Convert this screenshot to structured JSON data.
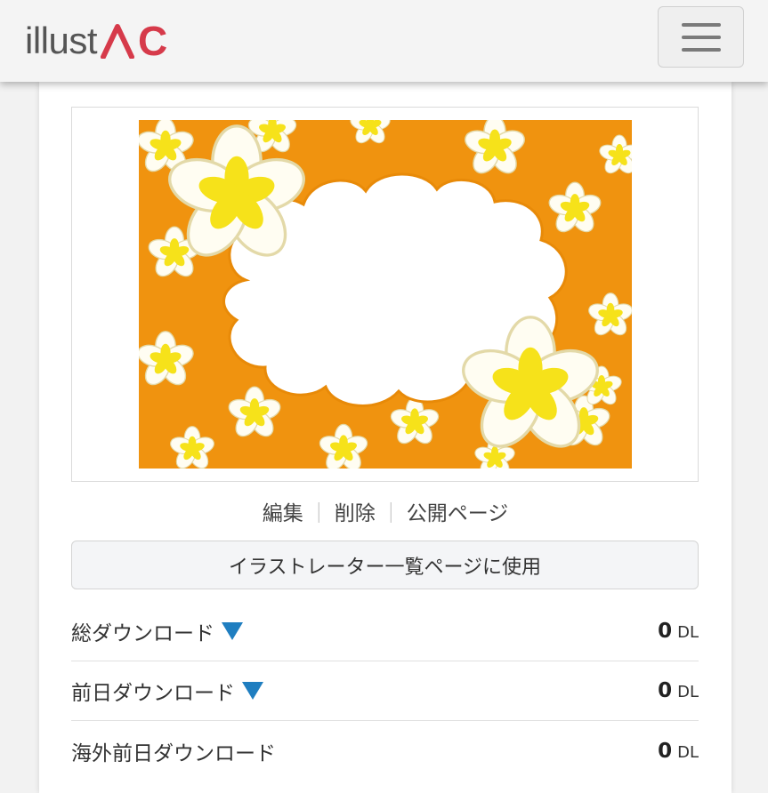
{
  "header": {
    "logo_text": "illust",
    "logo_mark": "AC",
    "menu_icon": "hamburger-menu-icon",
    "brand_color": "#d63a4a"
  },
  "preview": {
    "background_color": "#f0930f",
    "flower_color": "#f6e21a"
  },
  "actions": {
    "edit": "編集",
    "delete": "削除",
    "public_page": "公開ページ",
    "separator": "｜"
  },
  "use_button": {
    "label": "イラストレーター一覧ページに使用"
  },
  "stats": [
    {
      "label": "総ダウンロード",
      "value": "0",
      "unit": "DL",
      "has_sort_icon": true
    },
    {
      "label": "前日ダウンロード",
      "value": "0",
      "unit": "DL",
      "has_sort_icon": true
    },
    {
      "label": "海外前日ダウンロード",
      "value": "0",
      "unit": "DL",
      "has_sort_icon": false
    }
  ],
  "accent_color": "#1f7ec0"
}
